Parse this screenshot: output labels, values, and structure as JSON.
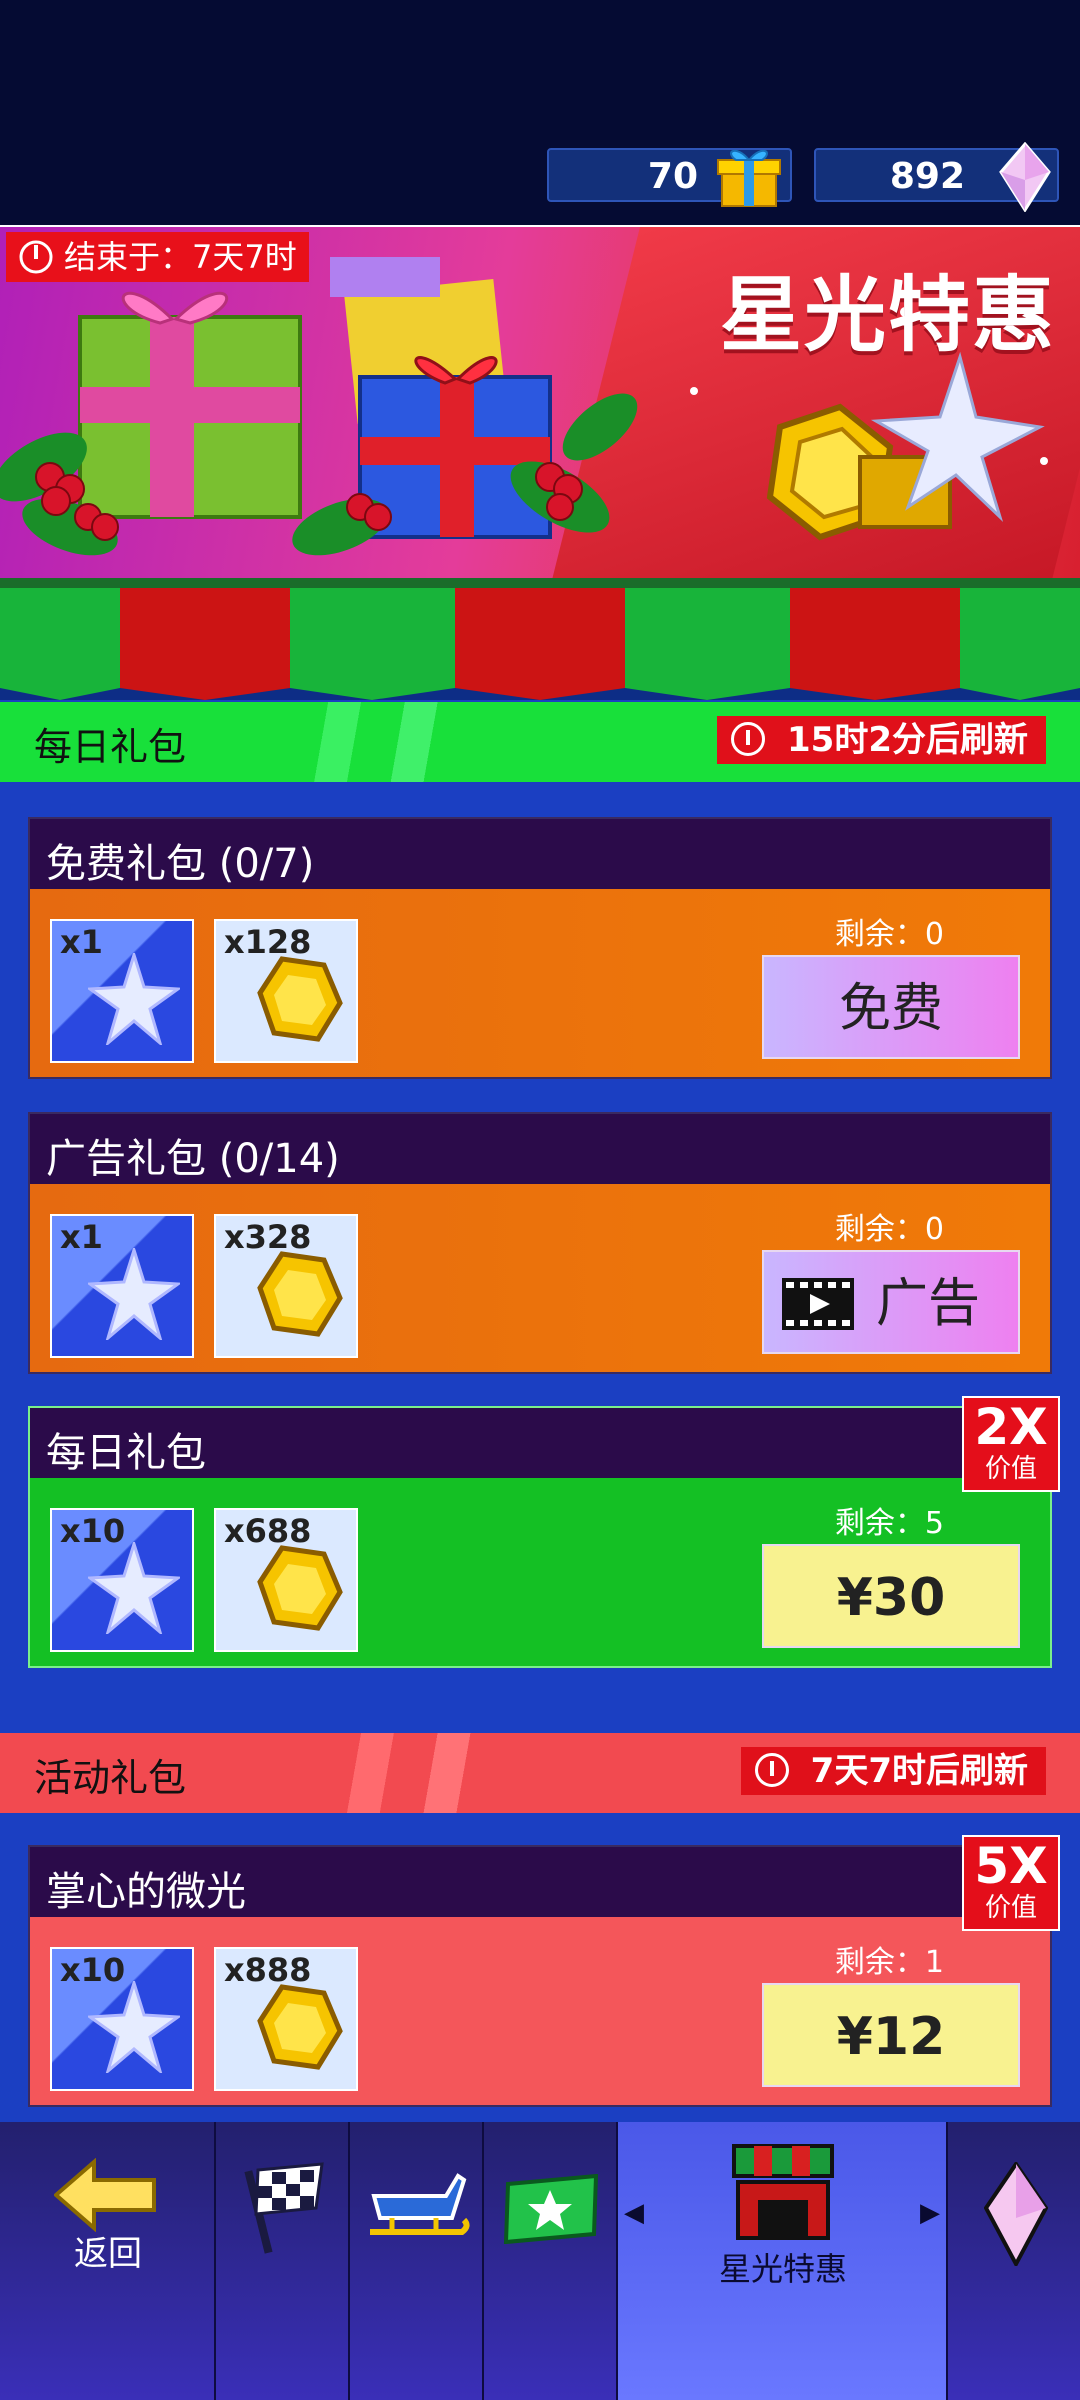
{
  "currencies": [
    {
      "value": "70",
      "icon": "gift-icon"
    },
    {
      "value": "892",
      "icon": "crystal-icon"
    }
  ],
  "banner": {
    "timer_label": "结束于：7天7时",
    "title": "星光特惠"
  },
  "daily_section": {
    "label": "每日礼包",
    "refresh": "15时2分后刷新"
  },
  "event_section": {
    "label": "活动礼包",
    "refresh": "7天7时后刷新"
  },
  "packs": [
    {
      "title": "免费礼包 (0/7)",
      "items": [
        {
          "qty": "x1",
          "icon": "star-crystal-icon"
        },
        {
          "qty": "x128",
          "icon": "gold-coin-icon"
        }
      ],
      "remaining": "剩余：0",
      "button": "免费"
    },
    {
      "title": "广告礼包 (0/14)",
      "items": [
        {
          "qty": "x1",
          "icon": "star-crystal-icon"
        },
        {
          "qty": "x328",
          "icon": "gold-coin-icon"
        }
      ],
      "remaining": "剩余：0",
      "button": "广告",
      "button_icon": "film-icon"
    },
    {
      "title": "每日礼包",
      "items": [
        {
          "qty": "x10",
          "icon": "star-crystal-icon"
        },
        {
          "qty": "x688",
          "icon": "gold-coin-icon"
        }
      ],
      "remaining": "剩余：5",
      "button": "¥30",
      "badge": {
        "mult": "2X",
        "text": "价值"
      }
    },
    {
      "title": "掌心的微光",
      "items": [
        {
          "qty": "x10",
          "icon": "star-crystal-icon"
        },
        {
          "qty": "x888",
          "icon": "gold-coin-icon"
        }
      ],
      "remaining": "剩余：1",
      "button": "¥12",
      "badge": {
        "mult": "5X",
        "text": "价值"
      }
    }
  ],
  "nav": {
    "back_label": "返回",
    "active_label": "星光特惠",
    "items": [
      "checkered-flag-icon",
      "sleigh-icon",
      "green-ticket-icon",
      "shop-awning-icon",
      "crystal-icon"
    ]
  },
  "colors": {
    "free_card": "#ee6e0c",
    "ad_card": "#ee6e0c",
    "daily_card": "#14c024",
    "event_card": "#f4565a",
    "daily_bar": "#18e03a",
    "event_bar": "#f24a50",
    "price_button": "#f8f290"
  }
}
